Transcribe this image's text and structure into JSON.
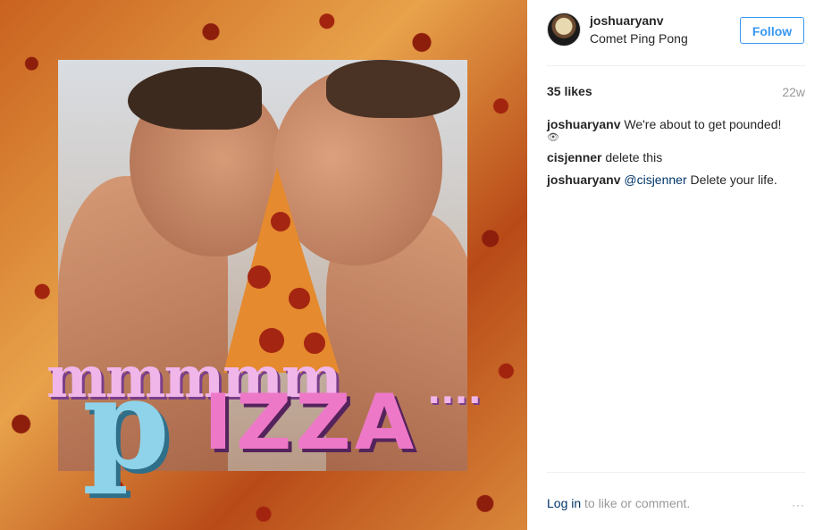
{
  "media": {
    "overlay_text": {
      "line1": "mmmmm",
      "p": "p",
      "izza": "IZZA",
      "dots": "...."
    }
  },
  "header": {
    "username": "joshuaryanv",
    "location": "Comet Ping Pong",
    "follow_label": "Follow"
  },
  "stats": {
    "likes": "35 likes",
    "time": "22w"
  },
  "comments": [
    {
      "user": "joshuaryanv",
      "text": "We're about to get pounded!",
      "emoji": "👁"
    },
    {
      "user": "cisjenner",
      "text": "delete this"
    },
    {
      "user": "joshuaryanv",
      "mention": "@cisjenner",
      "text": "Delete your life."
    }
  ],
  "footer": {
    "login_link": "Log in",
    "suffix": "to like or comment.",
    "more_icon": "···"
  }
}
